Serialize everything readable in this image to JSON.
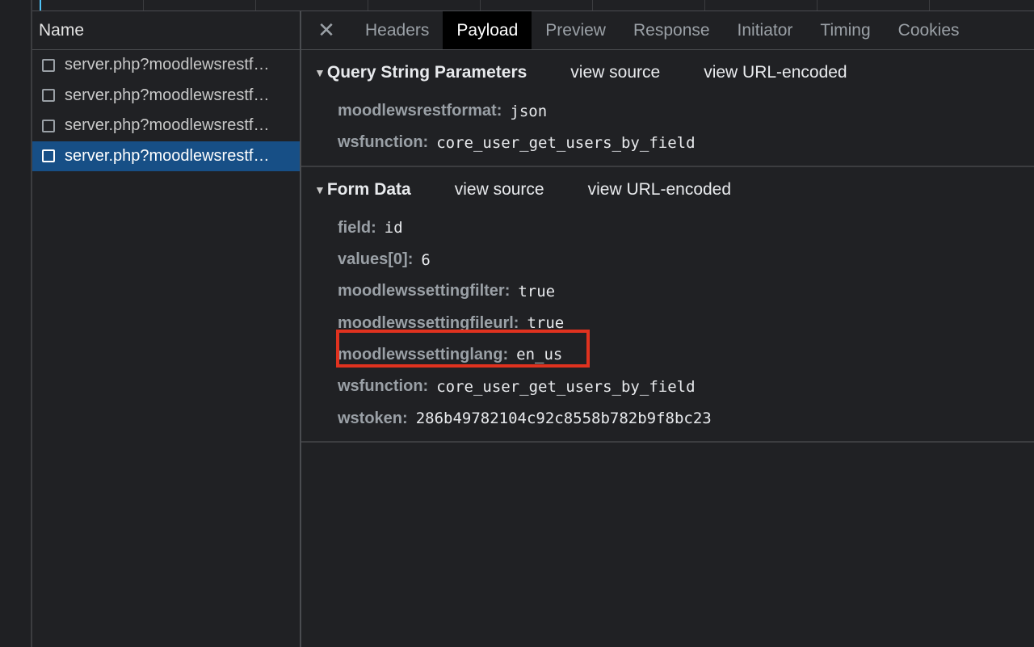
{
  "request_list": {
    "header": "Name",
    "items": [
      {
        "name": "server.php?moodlewsrestf…"
      },
      {
        "name": "server.php?moodlewsrestf…"
      },
      {
        "name": "server.php?moodlewsrestf…"
      },
      {
        "name": "server.php?moodlewsrestf…"
      }
    ],
    "selected_index": 3
  },
  "tabs": {
    "close_icon": "close-icon",
    "items": [
      {
        "label": "Headers"
      },
      {
        "label": "Payload"
      },
      {
        "label": "Preview"
      },
      {
        "label": "Response"
      },
      {
        "label": "Initiator"
      },
      {
        "label": "Timing"
      },
      {
        "label": "Cookies"
      }
    ],
    "active": "Payload"
  },
  "query_params": {
    "title": "Query String Parameters",
    "view_source": "view source",
    "view_url_encoded": "view URL-encoded",
    "rows": [
      {
        "key": "moodlewsrestformat:",
        "value": "json"
      },
      {
        "key": "wsfunction:",
        "value": "core_user_get_users_by_field"
      }
    ]
  },
  "form_data": {
    "title": "Form Data",
    "view_source": "view source",
    "view_url_encoded": "view URL-encoded",
    "rows": [
      {
        "key": "field:",
        "value": "id"
      },
      {
        "key": "values[0]:",
        "value": "6"
      },
      {
        "key": "moodlewssettingfilter:",
        "value": "true"
      },
      {
        "key": "moodlewssettingfileurl:",
        "value": "true"
      },
      {
        "key": "moodlewssettinglang:",
        "value": "en_us"
      },
      {
        "key": "wsfunction:",
        "value": "core_user_get_users_by_field"
      },
      {
        "key": "wstoken:",
        "value": "286b49782104c92c8558b782b9f8bc23"
      }
    ]
  },
  "colors": {
    "selected_row": "#174f86",
    "highlight": "#e0321f",
    "active_tab": "#000000"
  }
}
